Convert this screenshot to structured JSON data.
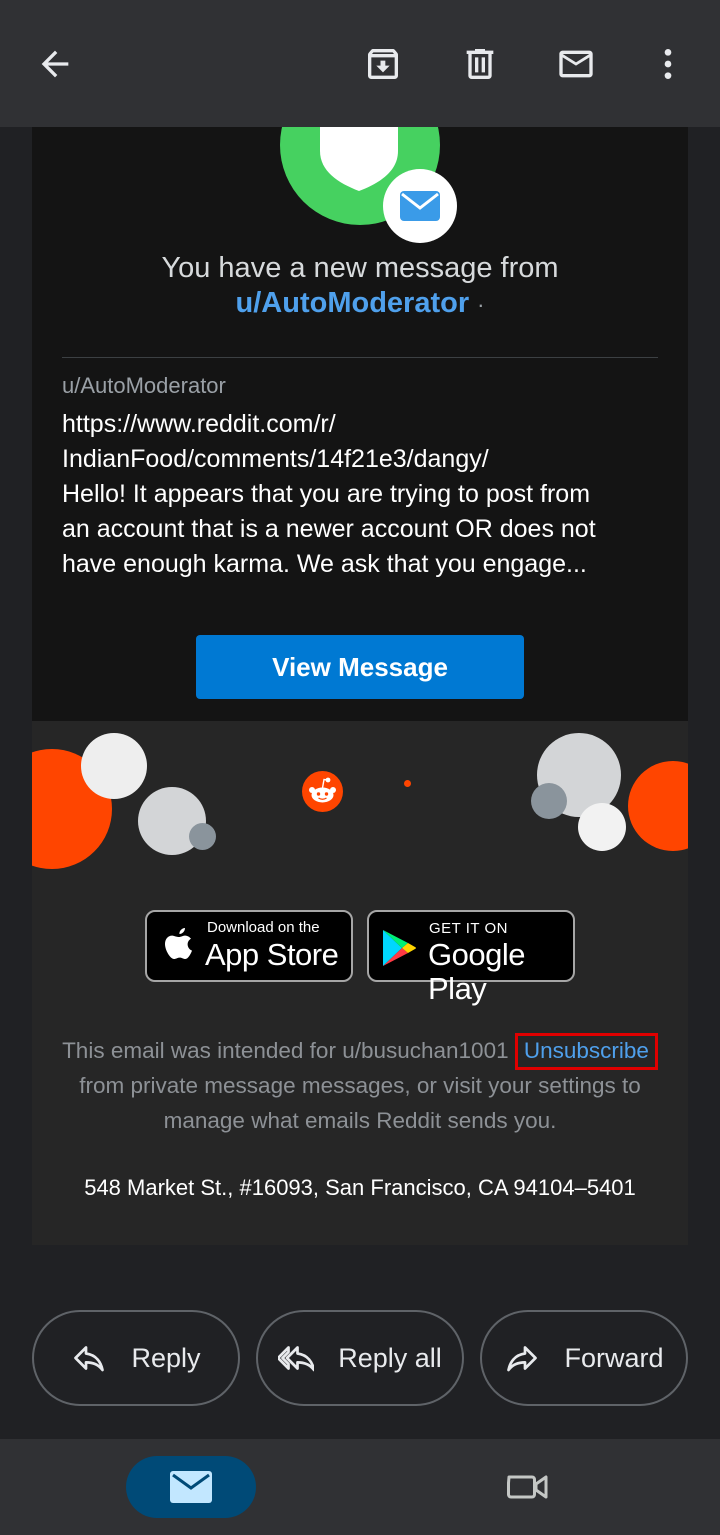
{
  "toolbar": {
    "back_icon": "arrow-back-icon",
    "archive_icon": "archive-icon",
    "delete_icon": "trash-icon",
    "mark_unread_icon": "mail-icon",
    "more_icon": "more-vert-icon"
  },
  "email": {
    "headline": "You have a new message from",
    "from_user": "u/AutoModerator",
    "from_dot": "·",
    "sender_label": "u/AutoModerator",
    "message_lines": [
      "https://www.reddit.com/r/",
      "IndianFood/comments/14f21e3/dangy/",
      "Hello! It appears that you are trying to post from",
      "an account that is a newer account OR does not",
      "have enough karma. We ask that you engage..."
    ],
    "view_button": "View Message"
  },
  "footer": {
    "app_store_small": "Download on the",
    "app_store_big": "App Store",
    "google_play_small": "GET IT ON",
    "google_play_big": "Google Play",
    "intended_text": "This email was intended for u/busuchan1001",
    "unsubscribe": "Unsubscribe",
    "line2": "from private message messages, or visit your settings to",
    "line3": "manage what emails Reddit sends you.",
    "address": "548 Market St., #16093, San Francisco, CA 94104–5401"
  },
  "actions": {
    "reply": "Reply",
    "reply_all": "Reply all",
    "forward": "Forward"
  },
  "bottom_nav": {
    "mail_icon": "mail-icon",
    "meet_icon": "video-camera-icon"
  },
  "colors": {
    "reddit_orange": "#ff4500",
    "link_blue": "#4fa0ec",
    "button_blue": "#0079d3",
    "avatar_green": "#46d160",
    "highlight_red": "#e00000"
  }
}
